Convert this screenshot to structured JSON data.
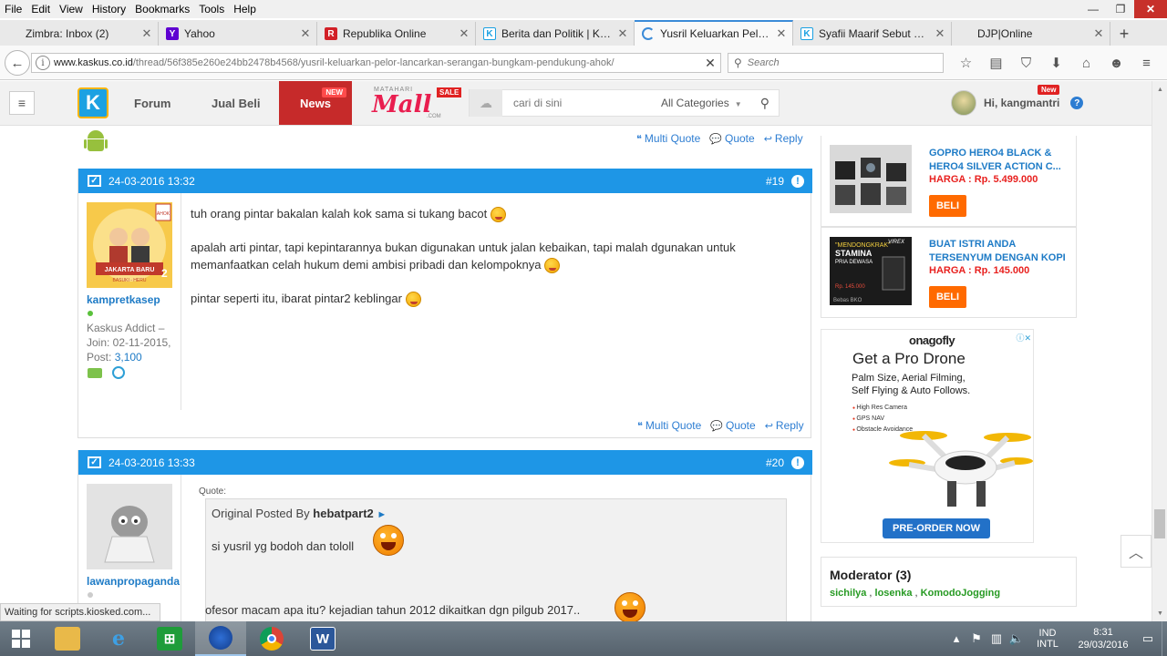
{
  "menubar": {
    "items": [
      "File",
      "Edit",
      "View",
      "History",
      "Bookmarks",
      "Tools",
      "Help"
    ]
  },
  "window_controls": {
    "minimize": "—",
    "restore": "❐",
    "close": "✕"
  },
  "tabs": [
    {
      "label": "Zimbra: Inbox (2)",
      "icon": "blank",
      "active": false
    },
    {
      "label": "Yahoo",
      "icon": "Y",
      "active": false
    },
    {
      "label": "Republika Online",
      "icon": "R",
      "active": false
    },
    {
      "label": "Berita dan Politik | KA...",
      "icon": "K",
      "active": false
    },
    {
      "label": "Yusril Keluarkan Pelor...",
      "icon": "spinner",
      "active": true
    },
    {
      "label": "Syafii Maarif Sebut Ka...",
      "icon": "K",
      "active": false
    },
    {
      "label": "DJP|Online",
      "icon": "blank",
      "active": false
    }
  ],
  "navbar": {
    "url_domain": "www.kaskus.co.id",
    "url_path": "/thread/56f385e260e24bb2478b4568/yusril-keluarkan-pelor-lancarkan-serangan-bungkam-pendukung-ahok/",
    "search_placeholder": "Search"
  },
  "site_header": {
    "nav_forum": "Forum",
    "nav_jualbeli": "Jual Beli",
    "nav_news": "News",
    "new_badge": "NEW",
    "mall_top": "MATAHARI",
    "mall_word": "Mall",
    "mall_com": ".COM",
    "sale_badge": "SALE",
    "search_placeholder": "cari di sini",
    "category": "All Categories",
    "greeting": "Hi, kangmantri",
    "user_new_badge": "New",
    "help": "?"
  },
  "actions": {
    "multi_quote": "Multi Quote",
    "quote": "Quote",
    "reply": "Reply"
  },
  "posts": [
    {
      "date": "24-03-2016 13:32",
      "number": "#19",
      "username": "kampretkasep",
      "rank": "Kaskus Addict –",
      "join": "Join: 02-11-2015,",
      "post_label": "Post:",
      "post_count": "3,100",
      "avatar_caption": "JAKARTA BARU",
      "avatar_sub": "BASUKI - HERU",
      "avatar_badge": "AHOK",
      "avatar_num": "2",
      "lines": [
        "tuh orang pintar bakalan kalah kok sama si tukang bacot",
        "apalah arti pintar, tapi kepintarannya bukan digunakan untuk jalan kebaikan, tapi malah dgunakan untuk",
        "memanfaatkan celah hukum demi ambisi pribadi dan kelompoknya",
        "pintar seperti itu, ibarat pintar2 keblingar"
      ]
    },
    {
      "date": "24-03-2016 13:33",
      "number": "#20",
      "username": "lawanpropaganda",
      "quote_label": "Quote:",
      "quote_prefix": "Original Posted By",
      "quote_author": "hebatpart2",
      "quote_arrow": "►",
      "quote_text": "si yusril yg bodoh dan tololl",
      "quote_tail": "ofesor macam apa itu? kejadian tahun 2012 dikaitkan dgn pilgub 2017.."
    }
  ],
  "products": [
    {
      "title_1": "GOPRO HERO4 BLACK &",
      "title_2": "HERO4 SILVER ACTION C...",
      "price": "HARGA : Rp. 5.499.000",
      "buy": "BELI"
    },
    {
      "title_1": "BUAT ISTRI ANDA",
      "title_2": "TERSENYUM DENGAN KOPI",
      "price": "HARGA : Rp. 145.000",
      "buy": "BELI",
      "img_text_1": "\"MENDONGKRAK\"",
      "img_text_2": "STAMINA",
      "img_text_3": "PRIA DEWASA",
      "img_brand": "VIREX",
      "img_price": "Rp. 145.000",
      "img_foot": "Bebas BKO"
    }
  ],
  "ad": {
    "brand": "onagofly",
    "adchoices": "ⓘ✕",
    "headline": "Get a Pro Drone",
    "sub_1": "Palm Size, Aerial Filming,",
    "sub_2": "Self Flying & Auto Follows.",
    "features": [
      "High Res Camera",
      "GPS NAV",
      "Obstacle Avoidance"
    ],
    "cta": "PRE-ORDER NOW"
  },
  "moderator": {
    "title": "Moderator (3)",
    "users": [
      "sichilya",
      "losenka",
      "KomodoJogging"
    ],
    "separator": " , "
  },
  "status_text": "Waiting for scripts.kiosked.com...",
  "tray": {
    "lang_1": "IND",
    "lang_2": "INTL",
    "time": "8:31",
    "date": "29/03/2016"
  },
  "colors": {
    "kaskus_blue": "#1e96e6",
    "news_red": "#c62a2a",
    "buy_orange": "#ff6a00",
    "moderator_green": "#279a23"
  }
}
